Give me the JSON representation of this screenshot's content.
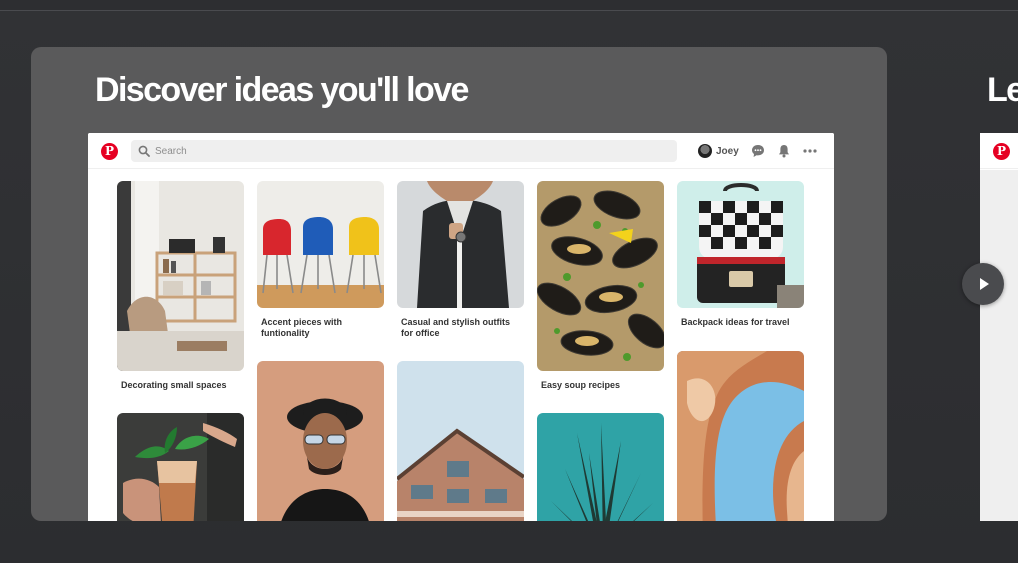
{
  "slide": {
    "title": "Discover ideas you'll love"
  },
  "next_slide": {
    "title_peek": "Le"
  },
  "app": {
    "logo_letter": "P",
    "brand_color": "#e60023",
    "search": {
      "placeholder": "Search",
      "value": ""
    },
    "user": {
      "name": "Joey"
    },
    "icons": [
      "search-icon",
      "chat-icon",
      "bell-icon",
      "more-icon"
    ]
  },
  "pins": [
    {
      "caption": "Decorating small spaces"
    },
    {
      "caption": "Accent pieces with funtionality"
    },
    {
      "caption": "Casual and stylish outfits for office"
    },
    {
      "caption": "Easy soup recipes"
    },
    {
      "caption": "Backpack ideas for travel"
    }
  ],
  "carousel": {
    "next_label": "next-slide"
  }
}
